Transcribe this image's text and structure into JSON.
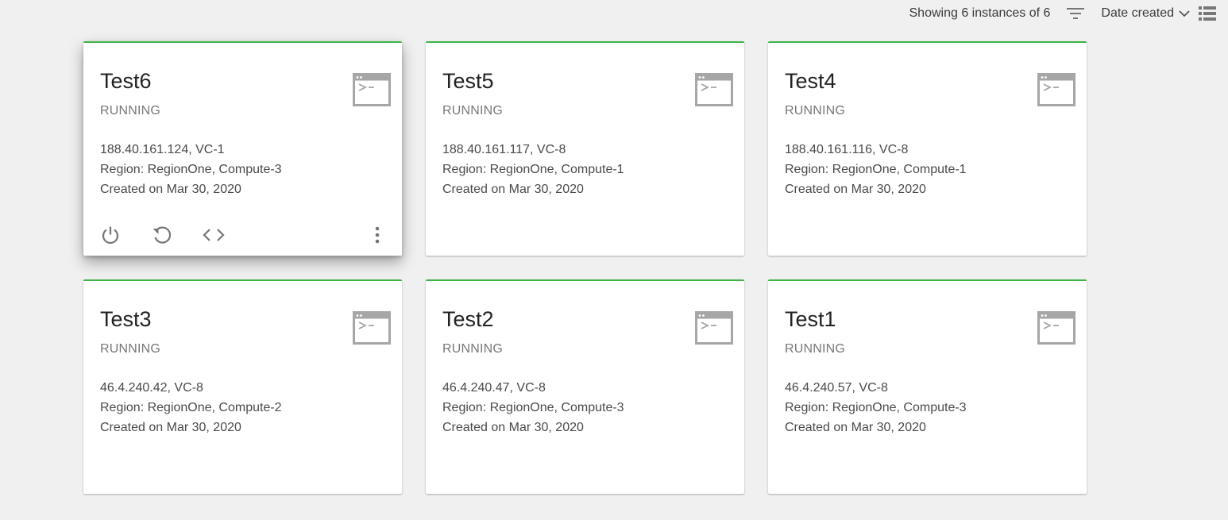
{
  "toolbar": {
    "showing_text": "Showing 6 instances of 6",
    "filter_icon": "filter-icon",
    "sort_label": "Date created",
    "sort_chevron_icon": "chevron-down-icon",
    "view_icon": "list-view-icon"
  },
  "colors": {
    "accent": "#3fb449",
    "background": "#f0f0f0",
    "card": "#ffffff",
    "status_text": "#777777",
    "icon_gray": "#a6a6a6"
  },
  "instances": [
    {
      "name": "Test6",
      "status": "RUNNING",
      "ip_vc": "188.40.161.124, VC-1",
      "region": "Region: RegionOne, Compute-3",
      "created": "Created on Mar 30, 2020",
      "icon": "console-icon",
      "hovered": true,
      "actions": [
        "power-icon",
        "restart-icon",
        "code-icon",
        "more-vertical-icon"
      ]
    },
    {
      "name": "Test5",
      "status": "RUNNING",
      "ip_vc": "188.40.161.117, VC-8",
      "region": "Region: RegionOne, Compute-1",
      "created": "Created on Mar 30, 2020",
      "icon": "console-icon"
    },
    {
      "name": "Test4",
      "status": "RUNNING",
      "ip_vc": "188.40.161.116, VC-8",
      "region": "Region: RegionOne, Compute-1",
      "created": "Created on Mar 30, 2020",
      "icon": "console-icon"
    },
    {
      "name": "Test3",
      "status": "RUNNING",
      "ip_vc": "46.4.240.42, VC-8",
      "region": "Region: RegionOne, Compute-2",
      "created": "Created on Mar 30, 2020",
      "icon": "console-icon"
    },
    {
      "name": "Test2",
      "status": "RUNNING",
      "ip_vc": "46.4.240.47, VC-8",
      "region": "Region: RegionOne, Compute-3",
      "created": "Created on Mar 30, 2020",
      "icon": "console-icon"
    },
    {
      "name": "Test1",
      "status": "RUNNING",
      "ip_vc": "46.4.240.57, VC-8",
      "region": "Region: RegionOne, Compute-3",
      "created": "Created on Mar 30, 2020",
      "icon": "console-icon"
    }
  ]
}
